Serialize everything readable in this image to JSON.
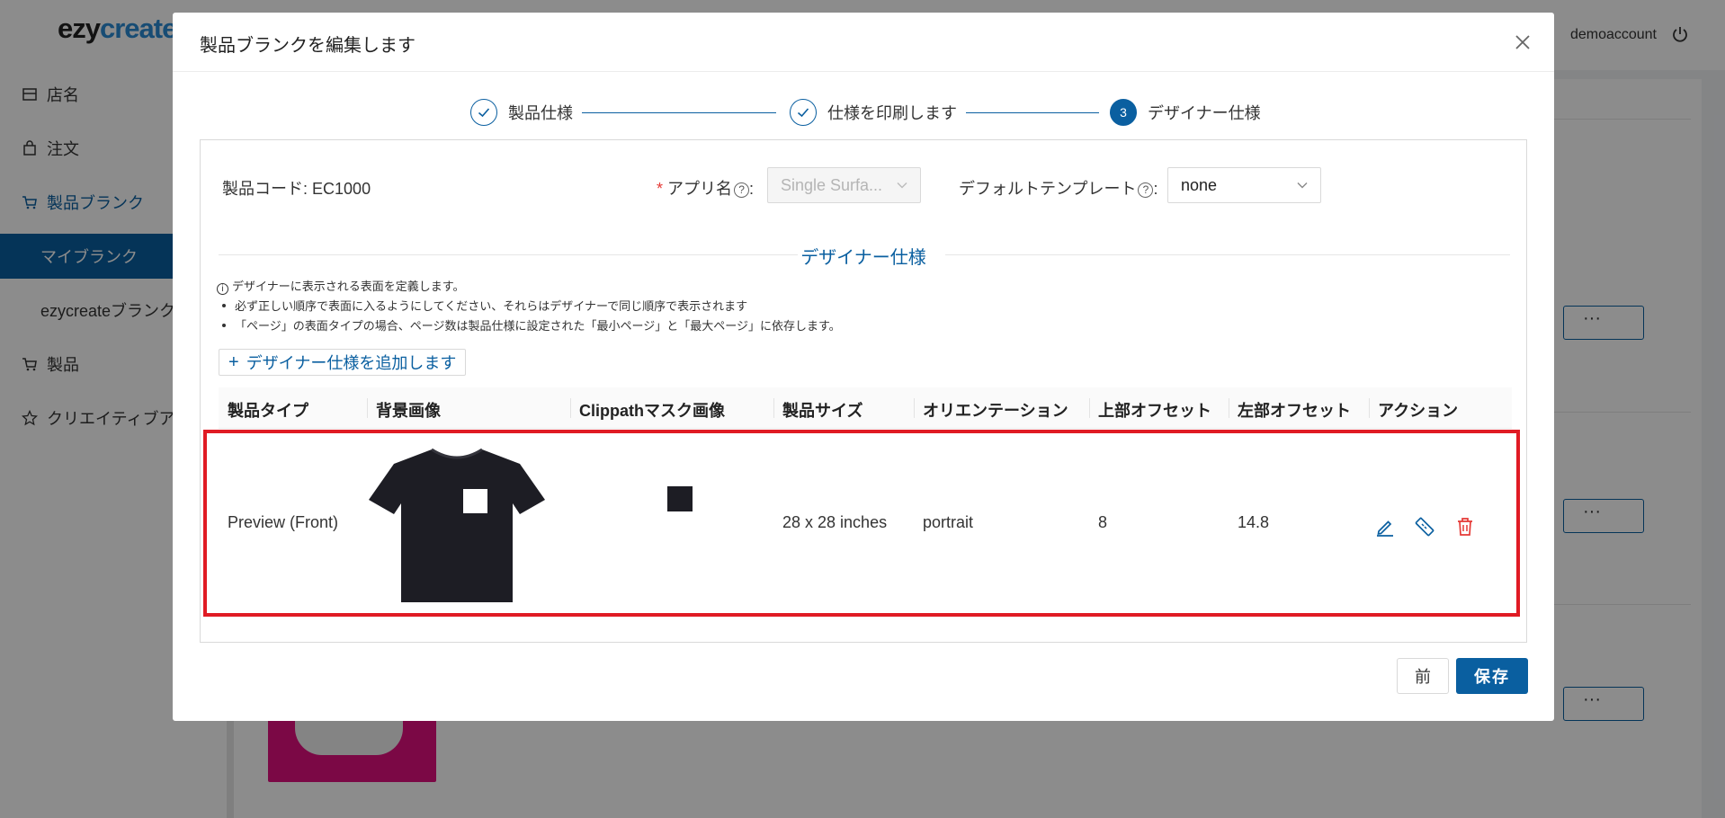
{
  "app": {
    "logo_part1": "ezy",
    "logo_part2": "create",
    "username": "demoaccount"
  },
  "sidebar": {
    "items": [
      {
        "label": "店名"
      },
      {
        "label": "注文"
      },
      {
        "label": "製品ブランク"
      },
      {
        "label": "マイブランク"
      },
      {
        "label": "ezycreateブランク"
      },
      {
        "label": "製品"
      },
      {
        "label": "クリエイティブア"
      }
    ]
  },
  "modal": {
    "title": "製品ブランクを編集します",
    "steps": [
      {
        "label": "製品仕様",
        "state": "done"
      },
      {
        "label": "仕様を印刷します",
        "state": "done"
      },
      {
        "label": "デザイナー仕様",
        "state": "active",
        "number": "3"
      }
    ],
    "form": {
      "product_code_label": "製品コード:",
      "product_code_value": "EC1000",
      "app_name_required": "*",
      "app_name_label": "アプリ名",
      "app_name_value": "Single Surfa...",
      "default_template_label": "デフォルトテンプレート",
      "default_template_value": "none",
      "help_glyph": "?",
      "colon": ":"
    },
    "section_title": "デザイナー仕様",
    "notes": [
      "デザイナーに表示される表面を定義します。",
      "必ず正しい順序で表面に入るようにしてください、それらはデザイナーで同じ順序で表示されます",
      "「ページ」の表面タイプの場合、ページ数は製品仕様に設定された「最小ページ」と「最大ページ」に依存します。"
    ],
    "info_glyph": "i",
    "add_button_label": "デザイナー仕様を追加します",
    "table": {
      "headers": [
        "製品タイプ",
        "背景画像",
        "Clippathマスク画像",
        "製品サイズ",
        "オリエンテーション",
        "上部オフセット",
        "左部オフセット",
        "アクション"
      ],
      "rows": [
        {
          "type": "Preview (Front)",
          "size": "28 x 28 inches",
          "orientation": "portrait",
          "top_offset": "8",
          "left_offset": "14.8"
        }
      ]
    },
    "buttons": {
      "prev": "前",
      "save": "保存"
    }
  },
  "colors": {
    "primary": "#0a5fa0",
    "danger": "#e01b24",
    "tshirt": "#1d1d24"
  },
  "icons": [
    "close-icon",
    "check-icon",
    "question-icon",
    "info-icon",
    "plus-icon",
    "chevron-down-icon",
    "edit-icon",
    "ruler-icon",
    "trash-icon",
    "power-icon",
    "store-icon",
    "bag-icon",
    "cart-icon",
    "star-icon"
  ]
}
